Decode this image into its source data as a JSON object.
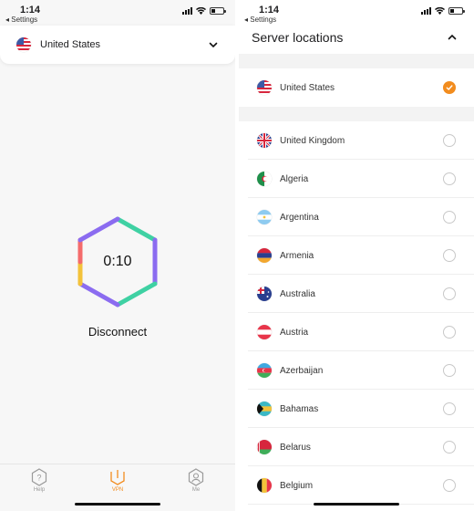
{
  "left_screen": {
    "status": {
      "time": "1:14",
      "back_label": "◂ Settings"
    },
    "selected_location": {
      "name": "United States",
      "flag": "flag-us-icon"
    },
    "timer": "0:10",
    "disconnect_label": "Disconnect",
    "tabs": [
      {
        "label": "Help",
        "icon": "help-icon",
        "active": false
      },
      {
        "label": "VPN",
        "icon": "vpn-icon",
        "active": true
      },
      {
        "label": "Me",
        "icon": "profile-icon",
        "active": false
      }
    ]
  },
  "right_screen": {
    "status": {
      "time": "1:14",
      "back_label": "◂ Settings"
    },
    "title": "Server locations",
    "selected": {
      "name": "United States",
      "checked": true
    },
    "locations": [
      {
        "name": "United Kingdom",
        "flag": "uk"
      },
      {
        "name": "Algeria",
        "flag": "dz"
      },
      {
        "name": "Argentina",
        "flag": "ar"
      },
      {
        "name": "Armenia",
        "flag": "am"
      },
      {
        "name": "Australia",
        "flag": "au"
      },
      {
        "name": "Austria",
        "flag": "at"
      },
      {
        "name": "Azerbaijan",
        "flag": "az"
      },
      {
        "name": "Bahamas",
        "flag": "bs"
      },
      {
        "name": "Belarus",
        "flag": "by"
      },
      {
        "name": "Belgium",
        "flag": "be"
      }
    ]
  },
  "colors": {
    "accent": "#f28c1e",
    "hex_green": "#3fd1a3",
    "hex_purple": "#8b6cf0",
    "hex_red": "#f46b6b",
    "hex_yellow": "#f3c23a"
  }
}
